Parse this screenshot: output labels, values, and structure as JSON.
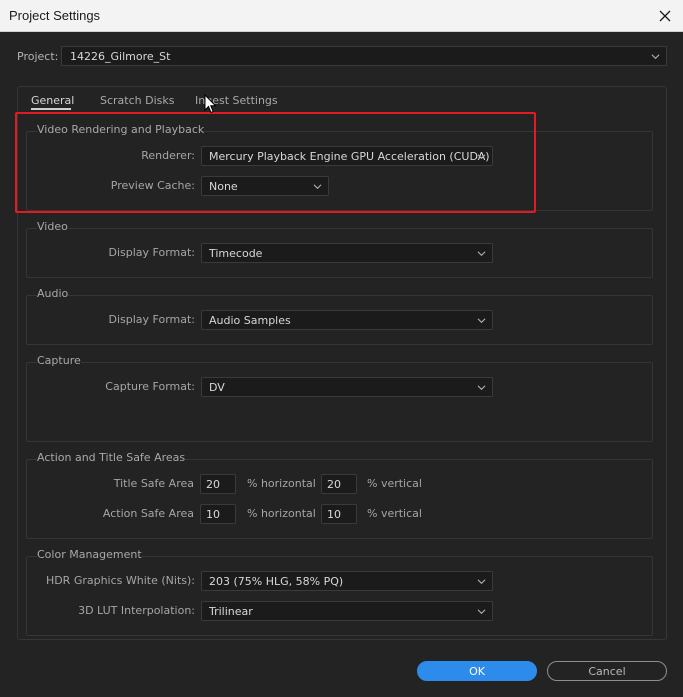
{
  "window": {
    "title": "Project Settings"
  },
  "project": {
    "label": "Project:",
    "value": "14226_Gilmore_St"
  },
  "tabs": [
    {
      "label": "General",
      "active": true
    },
    {
      "label": "Scratch Disks",
      "active": false
    },
    {
      "label": "Ingest Settings",
      "active": false
    }
  ],
  "video_rendering": {
    "title": "Video Rendering and Playback",
    "renderer_label": "Renderer:",
    "renderer_value": "Mercury Playback Engine GPU Acceleration (CUDA)",
    "preview_cache_label": "Preview Cache:",
    "preview_cache_value": "None"
  },
  "video": {
    "title": "Video",
    "display_format_label": "Display Format:",
    "display_format_value": "Timecode"
  },
  "audio": {
    "title": "Audio",
    "display_format_label": "Display Format:",
    "display_format_value": "Audio Samples"
  },
  "capture": {
    "title": "Capture",
    "capture_format_label": "Capture Format:",
    "capture_format_value": "DV"
  },
  "safe_areas": {
    "title": "Action and Title Safe Areas",
    "title_safe_label": "Title Safe Area",
    "title_safe_horizontal": "20",
    "title_safe_vertical": "20",
    "action_safe_label": "Action Safe Area",
    "action_safe_horizontal": "10",
    "action_safe_vertical": "10",
    "horizontal_unit": "% horizontal",
    "vertical_unit": "% vertical"
  },
  "color_management": {
    "title": "Color Management",
    "hdr_label": "HDR Graphics White (Nits):",
    "hdr_value": "203 (75% HLG, 58% PQ)",
    "lut_label": "3D LUT Interpolation:",
    "lut_value": "Trilinear"
  },
  "buttons": {
    "ok": "OK",
    "cancel": "Cancel"
  },
  "colors": {
    "background": "#232323",
    "accent": "#2d8ceb",
    "highlight": "#e01b24"
  }
}
